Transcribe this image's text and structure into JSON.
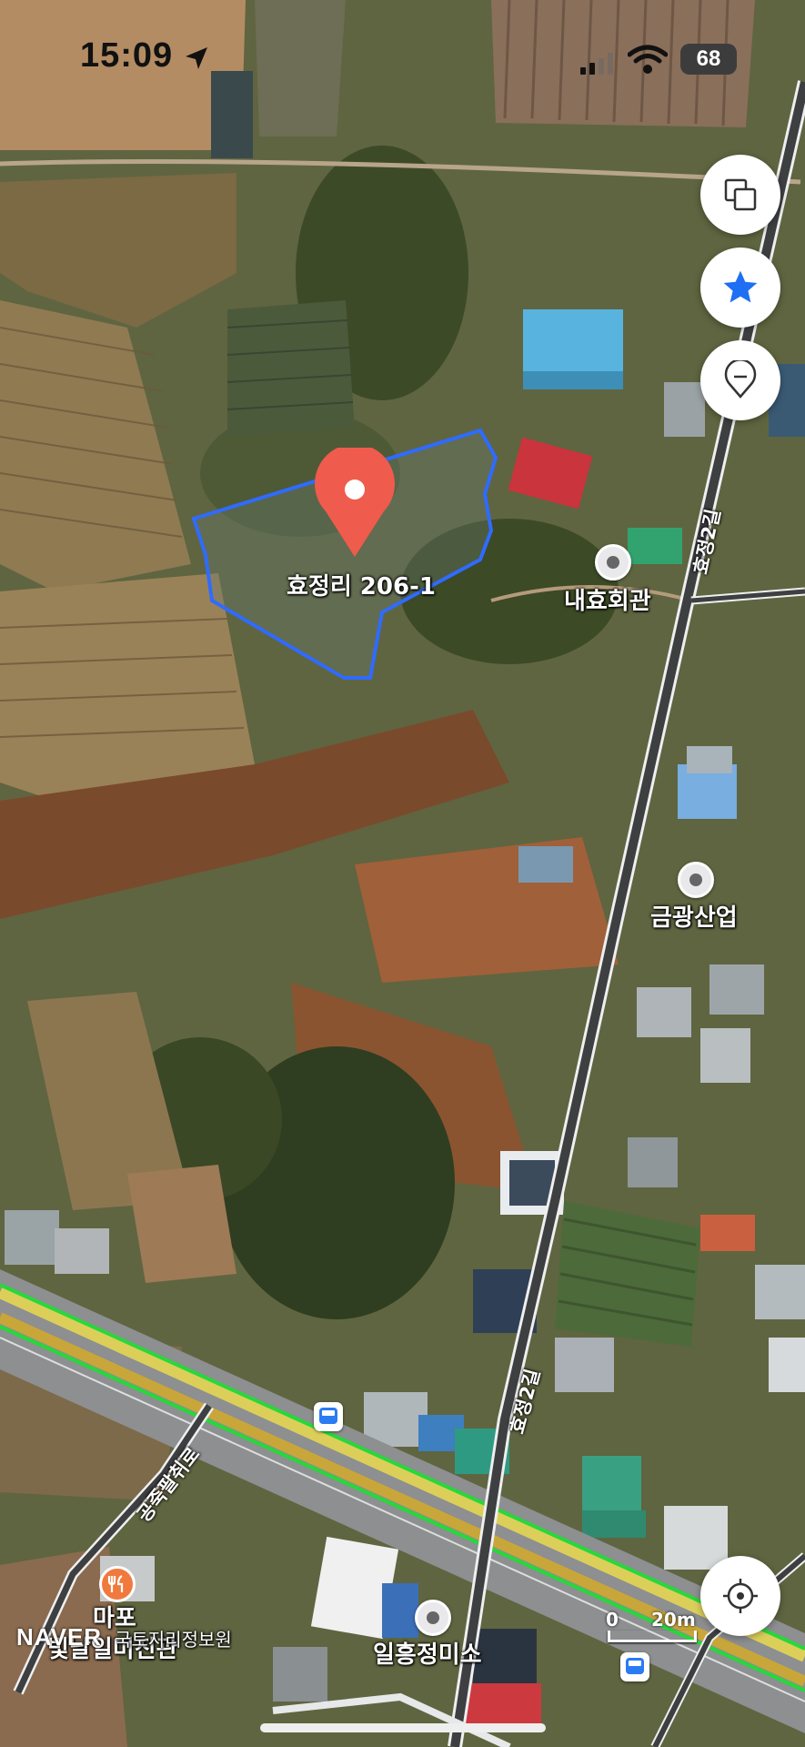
{
  "status_bar": {
    "time": "15:09",
    "battery": "68"
  },
  "map": {
    "parcel_label": "효정리 206-1",
    "places": [
      {
        "name": "내효회관",
        "icon": "building-poi-icon"
      },
      {
        "name": "금광산업",
        "icon": "office-poi-icon"
      },
      {
        "name": "일흥정미소",
        "icon": "building-poi-icon"
      },
      {
        "name": "마포",
        "icon": "restaurant-poi-icon"
      }
    ],
    "roads": {
      "r1": "효정2길",
      "r2": "효정2길",
      "r3": "공죽팔취로"
    },
    "overlapping_labels": {
      "a": "빛날일미진관",
      "b": "국토지리정보원"
    },
    "logo": "NAVER",
    "scale": {
      "zero": "0",
      "distance": "20m"
    }
  },
  "controls": {
    "layers_icon": "layers-icon",
    "favorite_icon": "star-icon",
    "pin_icon": "location-pin-icon",
    "locate_icon": "current-location-icon"
  },
  "colors": {
    "pin": "#ef5b4c",
    "parcel_outline": "#2f6bff",
    "favorite": "#1f6ff2",
    "route": "#27d83b"
  }
}
